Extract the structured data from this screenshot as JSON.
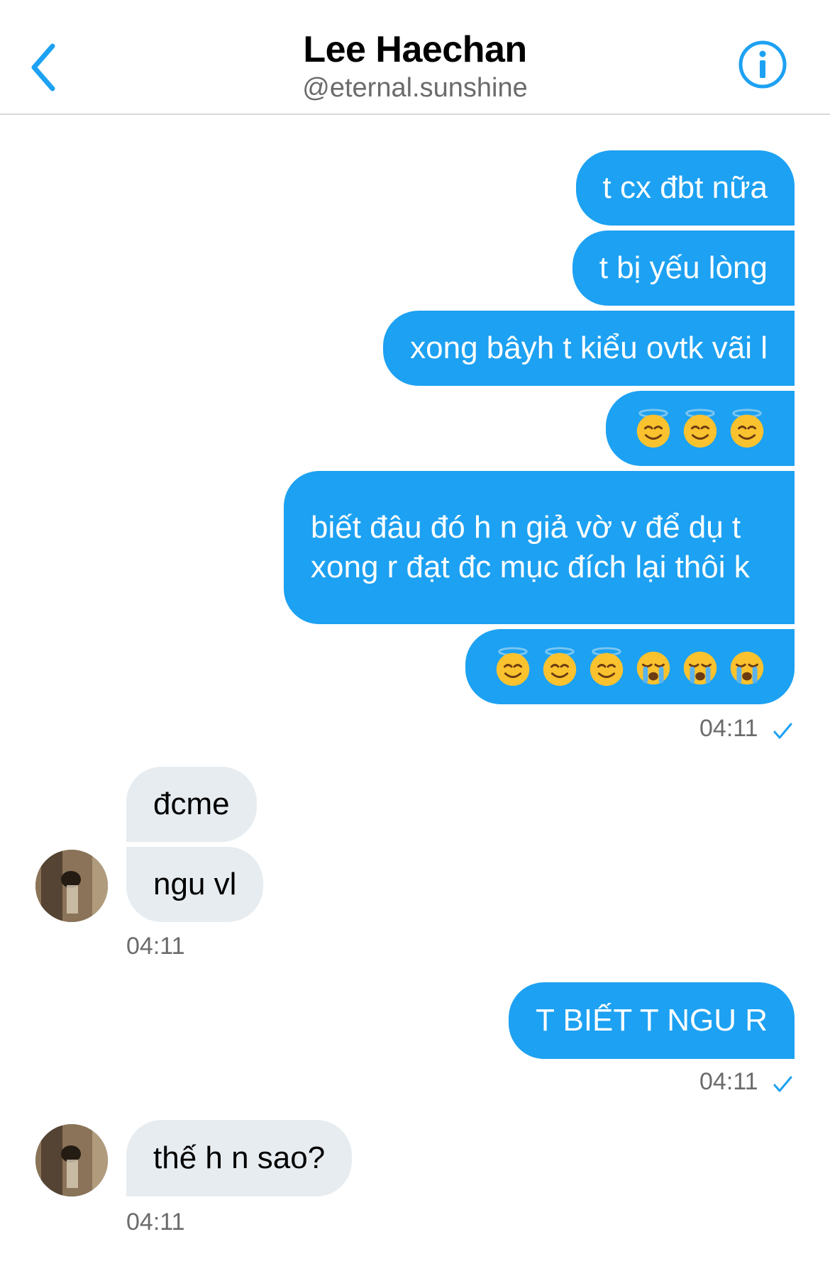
{
  "header": {
    "name": "Lee Haechan",
    "handle": "@eternal.sunshine"
  },
  "colors": {
    "accent": "#1da1f2",
    "incoming_bubble": "#e6ecf0",
    "timestamp": "#6b6b6b"
  },
  "messages_out_1": [
    {
      "text": "t cx đbt nữa"
    },
    {
      "text": "t bị yếu lòng"
    },
    {
      "text": "xong bâyh t kiểu ovtk vãi l"
    },
    {
      "emoji": [
        "smiling-face-with-halo",
        "smiling-face-with-halo",
        "smiling-face-with-halo"
      ]
    },
    {
      "text": "biết đâu đó h n giả vờ v để dụ t xong r đạt đc mục đích lại thôi k"
    },
    {
      "emoji": [
        "smiling-face-with-halo",
        "smiling-face-with-halo",
        "smiling-face-with-halo",
        "loudly-crying-face",
        "loudly-crying-face",
        "loudly-crying-face"
      ]
    }
  ],
  "time_out_1": "04:11",
  "messages_in_1": [
    "đcme",
    "ngu vl"
  ],
  "time_in_1": "04:11",
  "message_out_2": "T BIẾT T NGU R",
  "time_out_2": "04:11",
  "message_in_2": "thế h n sao?",
  "time_in_2": "04:11"
}
